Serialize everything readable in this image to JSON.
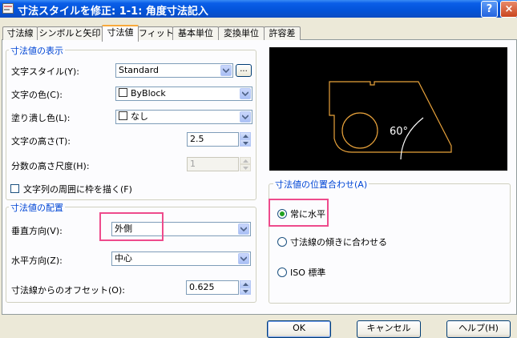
{
  "window": {
    "title": "寸法スタイルを修正: 1-1: 角度寸法記入",
    "help": "?",
    "close": "×"
  },
  "tabs": [
    "寸法線",
    "シンボルと矢印",
    "寸法値",
    "フィット",
    "基本単位",
    "変換単位",
    "許容差"
  ],
  "text_appearance": {
    "title": "寸法値の表示",
    "style_label": "文字スタイル(Y):",
    "style_value": "Standard",
    "browse_button": "...",
    "color_label": "文字の色(C):",
    "color_value": "ByBlock",
    "fill_label": "塗り潰し色(L):",
    "fill_value": "なし",
    "height_label": "文字の高さ(T):",
    "height_value": "2.5",
    "fraction_label": "分数の高さ尺度(H):",
    "fraction_value": "1",
    "frame_label": "文字列の周囲に枠を描く(F)"
  },
  "text_placement": {
    "title": "寸法値の配置",
    "vertical_label": "垂直方向(V):",
    "vertical_value": "外側",
    "horizontal_label": "水平方向(Z):",
    "horizontal_value": "中心",
    "offset_label": "寸法線からのオフセット(O):",
    "offset_value": "0.625"
  },
  "preview": {
    "angle_label": "60°",
    "line_color": "#e8a23b"
  },
  "text_alignment": {
    "title": "寸法値の位置合わせ(A)",
    "options": [
      "常に水平",
      "寸法線の傾きに合わせる",
      "ISO 標準"
    ],
    "selected": 0
  },
  "buttons": {
    "ok": "OK",
    "cancel": "キャンセル",
    "help": "ヘルプ(H)"
  },
  "colors": {
    "titlebar": "#0353d9",
    "group_title": "#0046d5",
    "highlight": "#ee4b8c",
    "radio_dot": "#21a121"
  }
}
